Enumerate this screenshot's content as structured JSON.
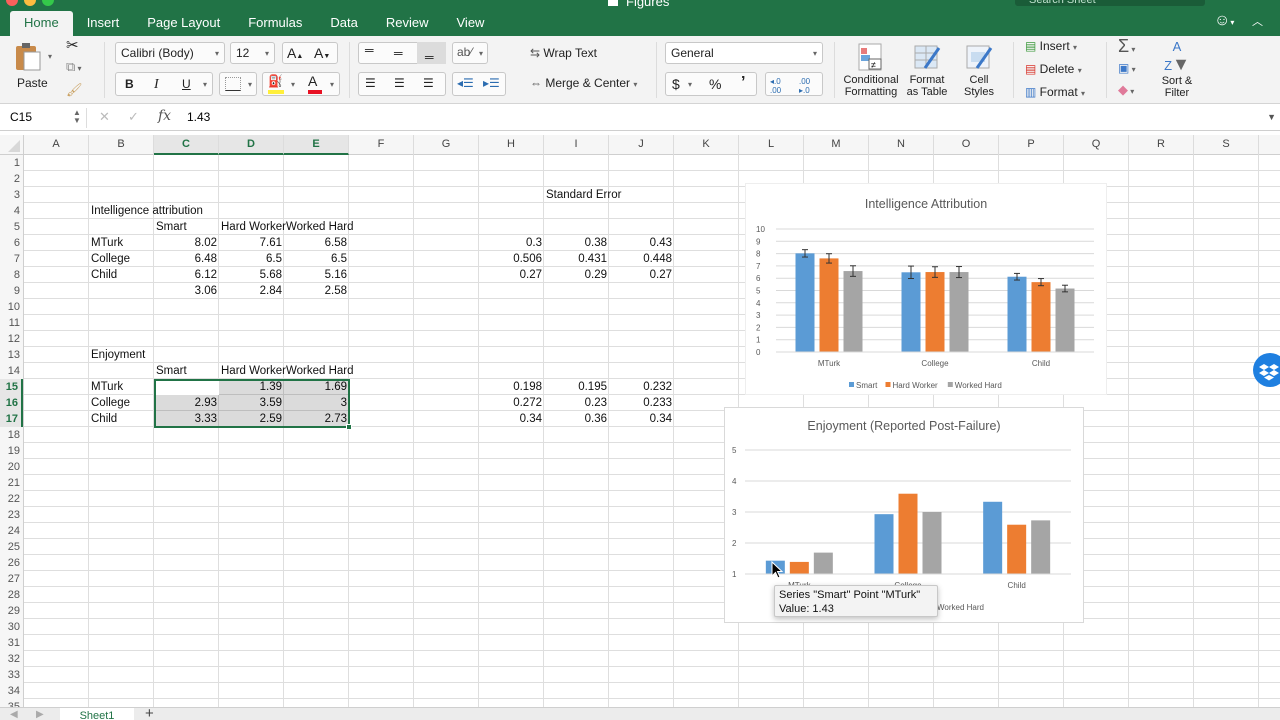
{
  "window": {
    "title": "Figures",
    "search_placeholder": "Search Sheet"
  },
  "ribbon_tabs": [
    "Home",
    "Insert",
    "Page Layout",
    "Formulas",
    "Data",
    "Review",
    "View"
  ],
  "active_tab": "Home",
  "ribbon": {
    "paste_label": "Paste",
    "font_name": "Calibri (Body)",
    "font_size": "12",
    "bold": "B",
    "italic": "I",
    "underline": "U",
    "wrap_text": "Wrap Text",
    "merge_center": "Merge & Center",
    "number_format": "General",
    "currency": "$",
    "percent": "%",
    "comma": "’",
    "conditional_formatting": [
      "Conditional",
      "Formatting"
    ],
    "format_as_table": [
      "Format",
      "as Table"
    ],
    "cell_styles": [
      "Cell",
      "Styles"
    ],
    "insert": "Insert",
    "delete": "Delete",
    "format": "Format",
    "sort_filter": [
      "Sort &",
      "Filter"
    ],
    "font_color": "#e81123",
    "fill_color": "#ffef3a"
  },
  "formula_bar": {
    "name_box": "C15",
    "value": "1.43",
    "fx": "fx"
  },
  "columns": [
    "A",
    "B",
    "C",
    "D",
    "E",
    "F",
    "G",
    "H",
    "I",
    "J",
    "K",
    "L",
    "M",
    "N",
    "O",
    "P",
    "Q",
    "R",
    "S"
  ],
  "selected_columns": [
    "C",
    "D",
    "E"
  ],
  "rows": [
    "1",
    "2",
    "3",
    "4",
    "5",
    "6",
    "7",
    "8",
    "9",
    "10",
    "11",
    "12",
    "13",
    "14",
    "15",
    "16",
    "17",
    "18",
    "19",
    "20",
    "21",
    "22",
    "23",
    "24",
    "25",
    "26",
    "27",
    "28",
    "29",
    "30",
    "31",
    "32",
    "33",
    "34",
    "35"
  ],
  "selected_rows": [
    "15",
    "16",
    "17"
  ],
  "cells": {
    "I3": "Standard Error",
    "B4": "Intelligence attribution",
    "C5": "Smart",
    "D5": "Hard Worker",
    "E5": "Worked Hard",
    "B6": "MTurk",
    "C6": "8.02",
    "D6": "7.61",
    "E6": "6.58",
    "H6": "0.3",
    "I6": "0.38",
    "J6": "0.43",
    "B7": "College",
    "C7": "6.48",
    "D7": "6.5",
    "E7": "6.5",
    "H7": "0.506",
    "I7": "0.431",
    "J7": "0.448",
    "B8": "Child",
    "C8": "6.12",
    "D8": "5.68",
    "E8": "5.16",
    "H8": "0.27",
    "I8": "0.29",
    "J8": "0.27",
    "C9": "3.06",
    "D9": "2.84",
    "E9": "2.58",
    "B13": "Enjoyment",
    "C14": "Smart",
    "D14": "Hard Worker",
    "E14": "Worked Hard",
    "B15": "MTurk",
    "C15": "1.43",
    "D15": "1.39",
    "E15": "1.69",
    "H15": "0.198",
    "I15": "0.195",
    "J15": "0.232",
    "B16": "College",
    "C16": "2.93",
    "D16": "3.59",
    "E16": "3",
    "H16": "0.272",
    "I16": "0.23",
    "J16": "0.233",
    "B17": "Child",
    "C17": "3.33",
    "D17": "2.59",
    "E17": "2.73",
    "H17": "0.34",
    "I17": "0.36",
    "J17": "0.34"
  },
  "chart_data": [
    {
      "type": "bar",
      "title": "Intelligence Attribution",
      "categories": [
        "MTurk",
        "College",
        "Child"
      ],
      "series": [
        {
          "name": "Smart",
          "color": "#5b9bd5",
          "values": [
            8.02,
            6.48,
            6.12
          ],
          "errors": [
            0.3,
            0.506,
            0.27
          ]
        },
        {
          "name": "Hard Worker",
          "color": "#ed7d31",
          "values": [
            7.61,
            6.5,
            5.68
          ],
          "errors": [
            0.38,
            0.431,
            0.29
          ]
        },
        {
          "name": "Worked Hard",
          "color": "#a5a5a5",
          "values": [
            6.58,
            6.5,
            5.16
          ],
          "errors": [
            0.43,
            0.448,
            0.27
          ]
        }
      ],
      "ylim": [
        0,
        10
      ],
      "yticks": [
        "0",
        "1",
        "2",
        "3",
        "4",
        "5",
        "6",
        "7",
        "8",
        "9",
        "10"
      ],
      "grid": true,
      "legend": "bottom"
    },
    {
      "type": "bar",
      "title": "Enjoyment (Reported Post-Failure)",
      "categories": [
        "MTurk",
        "College",
        "Child"
      ],
      "series": [
        {
          "name": "Smart",
          "color": "#5b9bd5",
          "values": [
            1.43,
            2.93,
            3.33
          ]
        },
        {
          "name": "Hard Worker",
          "color": "#ed7d31",
          "values": [
            1.39,
            3.59,
            2.59
          ]
        },
        {
          "name": "Worked Hard",
          "color": "#a5a5a5",
          "values": [
            1.69,
            3,
            2.73
          ]
        }
      ],
      "ylim": [
        1,
        5
      ],
      "yticks": [
        "1",
        "2",
        "3",
        "4",
        "5"
      ],
      "grid": true,
      "legend": "bottom",
      "legend_visible_text": "Worked Hard"
    }
  ],
  "tooltip": {
    "line1": "Series \"Smart\" Point \"MTurk\"",
    "line2": "Value: 1.43"
  },
  "sheets": [
    "Sheet1"
  ],
  "add_sheet": "+"
}
